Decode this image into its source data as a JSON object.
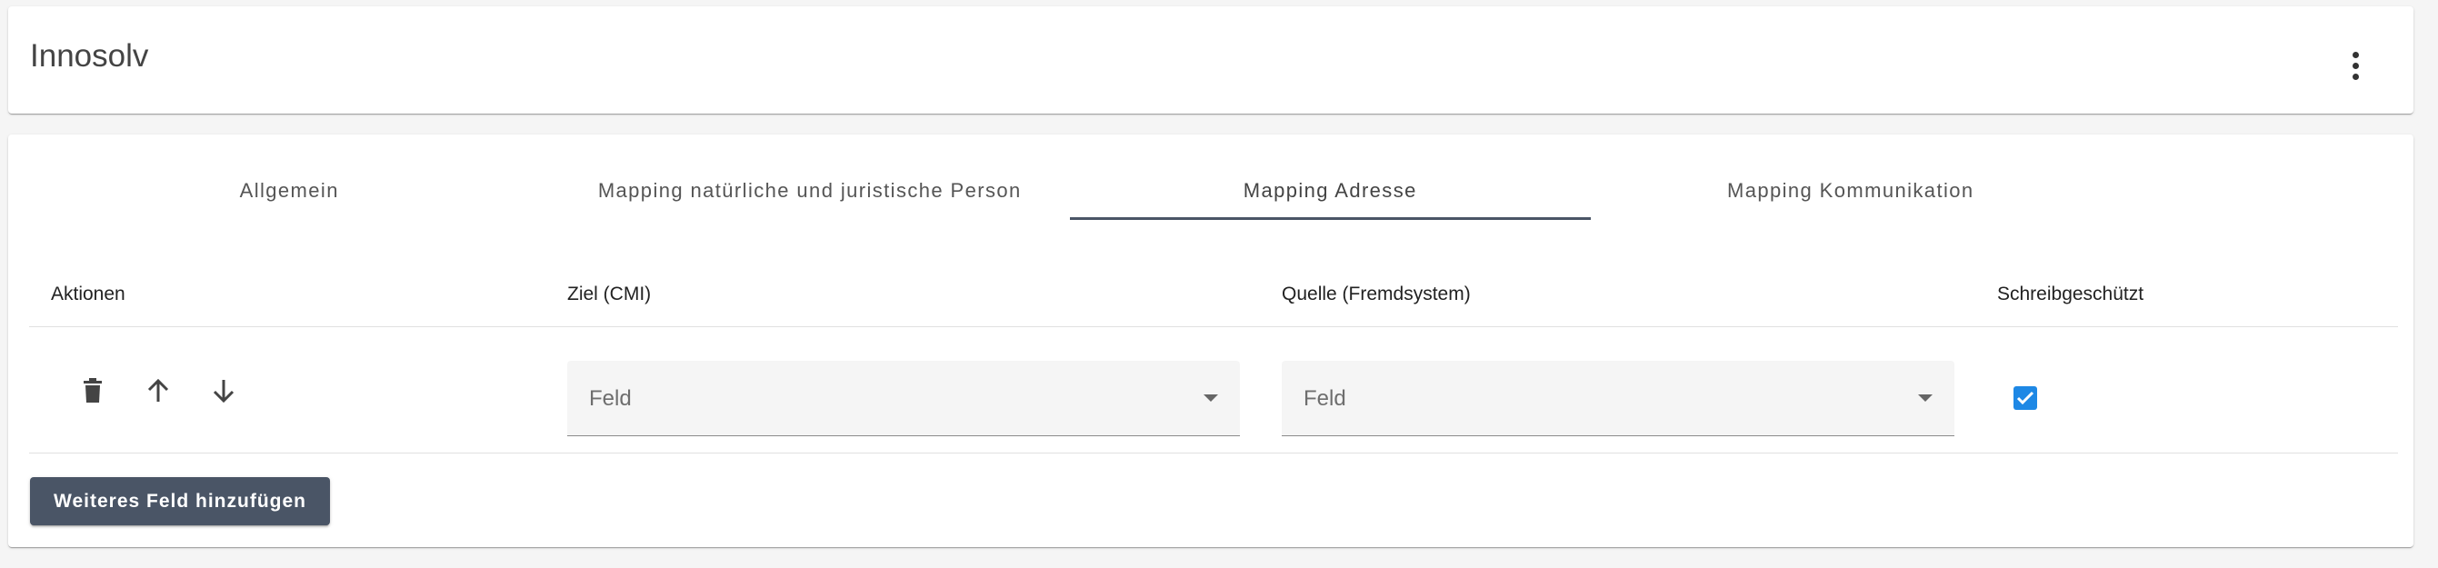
{
  "header": {
    "title": "Innosolv",
    "menu_icon": "more-vert-icon"
  },
  "tabs": [
    {
      "label": "Allgemein",
      "active": false
    },
    {
      "label": "Mapping natürliche und juristische Person",
      "active": false
    },
    {
      "label": "Mapping Adresse",
      "active": true
    },
    {
      "label": "Mapping Kommunikation",
      "active": false
    }
  ],
  "table": {
    "columns": [
      "Aktionen",
      "Ziel (CMI)",
      "Quelle (Fremdsystem)",
      "Schreibgeschützt"
    ],
    "rows": [
      {
        "actions": [
          "delete-icon",
          "arrow-up-icon",
          "arrow-down-icon"
        ],
        "target_placeholder": "Feld",
        "source_placeholder": "Feld",
        "readonly": true
      }
    ]
  },
  "add_button_label": "Weiteres Feld hinzufügen",
  "colors": {
    "accent": "#4a5566",
    "checkbox": "#1e88e5",
    "field_background": "#f5f5f5"
  }
}
